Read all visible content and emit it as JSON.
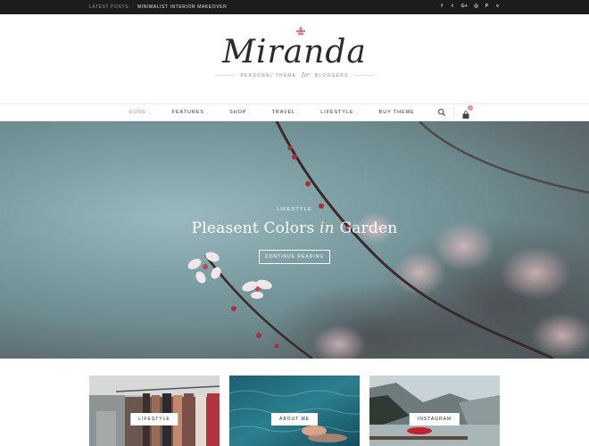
{
  "topbar": {
    "latest_label": "Latest Posts:",
    "latest_title": "Minimalist Interior Makeover",
    "social_icons": [
      "facebook-icon",
      "twitter-icon",
      "google-plus-icon",
      "instagram-icon",
      "pinterest-icon",
      "vimeo-icon"
    ],
    "social_glyphs": [
      "f",
      "t",
      "G+",
      "◎",
      "P",
      "v"
    ]
  },
  "brand": {
    "logo": "Miranda",
    "tagline_pre": "Personal Theme",
    "tagline_italic": "for",
    "tagline_post": "Bloggers"
  },
  "nav": {
    "items": [
      {
        "label": "Home"
      },
      {
        "label": "Features"
      },
      {
        "label": "Shop"
      },
      {
        "label": "Travel"
      },
      {
        "label": "Lifestyle"
      },
      {
        "label": "Buy Theme"
      }
    ],
    "caret": "⌄",
    "cart_count": "0",
    "accent": "#e0878f"
  },
  "hero": {
    "category": "Lifestyle",
    "title_pre": "Pleasent Colors",
    "title_italic": "in",
    "title_post": "Garden",
    "button": "Continue Reading"
  },
  "promos": [
    {
      "label": "Lifestyle"
    },
    {
      "label": "About Me"
    },
    {
      "label": "Instagram"
    }
  ]
}
